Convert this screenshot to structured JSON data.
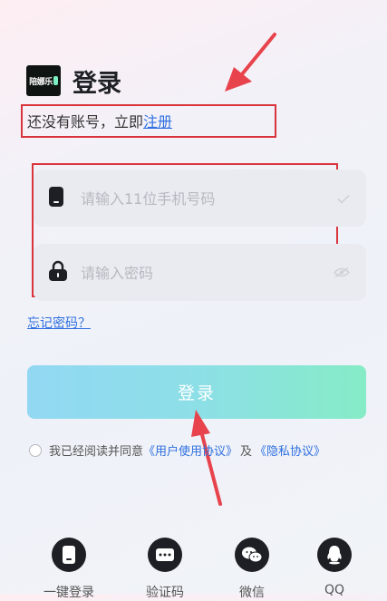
{
  "header": {
    "logo_text": "陪娜乐",
    "title": "登录",
    "subtitle": "还没有账号，立即",
    "register_link": "注册"
  },
  "form": {
    "phone_placeholder": "请输入11位手机号码",
    "password_placeholder": "请输入密码",
    "forgot_password": "忘记密码？",
    "login_button": "登录"
  },
  "agreement": {
    "prefix": "我已经阅读并同意",
    "user_agreement": "《用户使用协议》",
    "and": "及",
    "privacy_agreement": "《隐私协议》",
    "checked": false
  },
  "methods": [
    {
      "label": "一键登录",
      "icon": "phone-icon"
    },
    {
      "label": "验证码",
      "icon": "sms-code-icon"
    },
    {
      "label": "微信",
      "icon": "wechat-icon"
    },
    {
      "label": "QQ",
      "icon": "qq-icon"
    }
  ],
  "colors": {
    "link": "#2f6fe0",
    "annotation": "#d9343b",
    "button_gradient_start": "#92d8f3",
    "button_gradient_end": "#85ecc6"
  }
}
